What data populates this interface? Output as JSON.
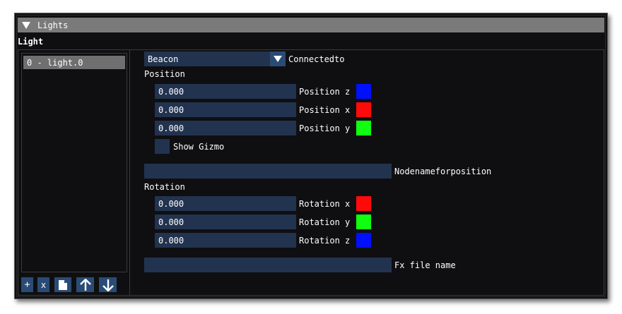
{
  "window": {
    "title": "Lights"
  },
  "section": {
    "label": "Light"
  },
  "light_list": {
    "items": [
      "0 - light.0"
    ]
  },
  "list_buttons": {
    "add": "+",
    "remove": "x"
  },
  "connected": {
    "selected": "Beacon",
    "label": "Connectedto"
  },
  "position": {
    "header": "Position",
    "fields": [
      {
        "value": "0.000",
        "label": "Position z",
        "color": "#0010ff"
      },
      {
        "value": "0.000",
        "label": "Position x",
        "color": "#ff0a0a"
      },
      {
        "value": "0.000",
        "label": "Position y",
        "color": "#10ff10"
      }
    ],
    "gizmo_label": "Show Gizmo"
  },
  "node": {
    "value": "",
    "label": "Nodenameforposition"
  },
  "rotation": {
    "header": "Rotation",
    "fields": [
      {
        "value": "0.000",
        "label": "Rotation x",
        "color": "#ff0a0a"
      },
      {
        "value": "0.000",
        "label": "Rotation y",
        "color": "#10ff10"
      },
      {
        "value": "0.000",
        "label": "Rotation z",
        "color": "#0010ff"
      }
    ]
  },
  "fx": {
    "value": "",
    "label": "Fx file name"
  },
  "icons": {
    "collapse": "triangle-down-icon",
    "dropdown": "chevron-down-icon",
    "copy": "copy-icon",
    "up": "arrow-up-icon",
    "down": "arrow-down-icon"
  }
}
